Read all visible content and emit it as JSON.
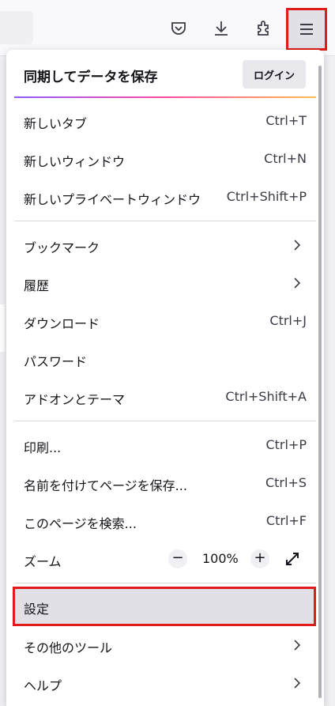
{
  "toolbar": {
    "pocket_icon": "pocket-icon",
    "download_icon": "download-icon",
    "extensions_icon": "extensions-icon",
    "menu_icon": "hamburger-menu-icon"
  },
  "menu": {
    "sync_title": "同期してデータを保存",
    "login_label": "ログイン",
    "new_tab": {
      "label": "新しいタブ",
      "shortcut": "Ctrl+T"
    },
    "new_window": {
      "label": "新しいウィンドウ",
      "shortcut": "Ctrl+N"
    },
    "new_private_window": {
      "label": "新しいプライベートウィンドウ",
      "shortcut": "Ctrl+Shift+P"
    },
    "bookmarks": {
      "label": "ブックマーク"
    },
    "history": {
      "label": "履歴"
    },
    "downloads": {
      "label": "ダウンロード",
      "shortcut": "Ctrl+J"
    },
    "passwords": {
      "label": "パスワード"
    },
    "addons": {
      "label": "アドオンとテーマ",
      "shortcut": "Ctrl+Shift+A"
    },
    "print": {
      "label": "印刷...",
      "shortcut": "Ctrl+P"
    },
    "save_page": {
      "label": "名前を付けてページを保存...",
      "shortcut": "Ctrl+S"
    },
    "find": {
      "label": "このページを検索...",
      "shortcut": "Ctrl+F"
    },
    "zoom": {
      "label": "ズーム",
      "minus": "−",
      "value": "100%",
      "plus": "+"
    },
    "settings": {
      "label": "設定"
    },
    "more_tools": {
      "label": "その他のツール"
    },
    "help": {
      "label": "ヘルプ"
    }
  },
  "colors": {
    "highlight_border": "#e01b1b",
    "menu_background": "#ffffff"
  }
}
